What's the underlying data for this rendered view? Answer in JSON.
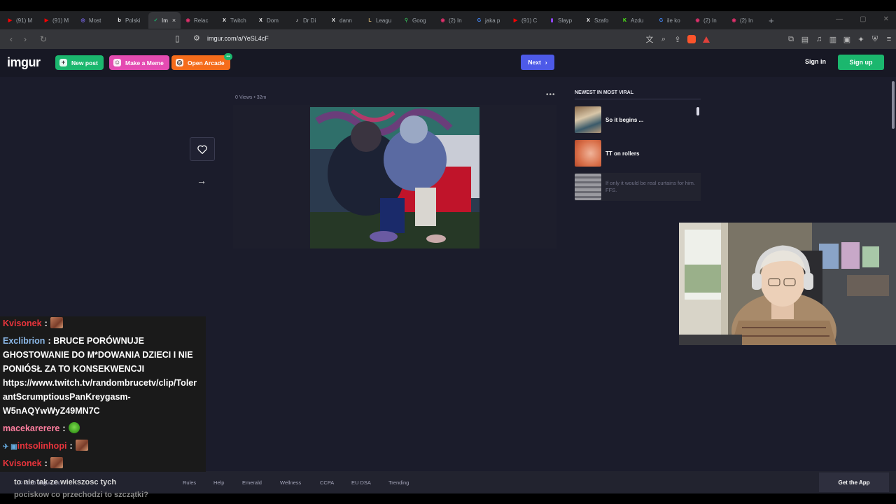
{
  "browser": {
    "tabs": [
      {
        "label": "(91) M",
        "icon": "youtube-icon",
        "color": "#ff0000"
      },
      {
        "label": "(91) M",
        "icon": "youtube-icon",
        "color": "#ff0000"
      },
      {
        "label": "Most",
        "icon": "globe-icon",
        "color": "#7b68ee"
      },
      {
        "label": "Polski",
        "icon": "bing-icon",
        "color": "#ffffff"
      },
      {
        "label": "Im",
        "icon": "imgur-icon",
        "color": "#1bb76e",
        "active": true
      },
      {
        "label": "Relac",
        "icon": "instagram-icon",
        "color": "#e1306c"
      },
      {
        "label": "Twitch",
        "icon": "x-icon",
        "color": "#ffffff"
      },
      {
        "label": "Dom",
        "icon": "x-icon",
        "color": "#ffffff"
      },
      {
        "label": "Dr Di",
        "icon": "tiktok-icon",
        "color": "#ffffff"
      },
      {
        "label": "dann",
        "icon": "x-icon",
        "color": "#ffffff"
      },
      {
        "label": "Leagu",
        "icon": "league-icon",
        "color": "#c8aa6e"
      },
      {
        "label": "Goog",
        "icon": "maps-icon",
        "color": "#34a853"
      },
      {
        "label": "(2) In",
        "icon": "instagram-icon",
        "color": "#e1306c"
      },
      {
        "label": "jaka p",
        "icon": "google-icon",
        "color": "#4285f4"
      },
      {
        "label": "(91) C",
        "icon": "youtube-icon",
        "color": "#ff0000"
      },
      {
        "label": "Slayp",
        "icon": "twitch-icon",
        "color": "#9146ff"
      },
      {
        "label": "Szafo",
        "icon": "x-icon",
        "color": "#ffffff"
      },
      {
        "label": "Azdu",
        "icon": "kick-icon",
        "color": "#53fc18"
      },
      {
        "label": "ile ko",
        "icon": "google-icon",
        "color": "#4285f4"
      },
      {
        "label": "(2) In",
        "icon": "instagram-icon",
        "color": "#e1306c"
      },
      {
        "label": "(2) In",
        "icon": "instagram-icon",
        "color": "#e1306c"
      }
    ],
    "new_tab": "+",
    "url": "imgur.com/a/YeSL4cF"
  },
  "imgur": {
    "logo": "imgur",
    "new_post": "New post",
    "make_meme": "Make a Meme",
    "open_arcade": "Open Arcade",
    "next": "Next",
    "sign_in": "Sign in",
    "sign_up": "Sign up",
    "post_meta": "0 Views • 32m",
    "viral_title": "NEWEST IN MOST VIRAL",
    "viral": [
      {
        "label": "So it begins ..."
      },
      {
        "label": "TT on rollers"
      },
      {
        "label": "If only it would be real curtains for him. FFS."
      }
    ],
    "footer": {
      "copyright": "© 2026 Imgur, Inc.",
      "links": [
        "Rules",
        "Help",
        "Emerald",
        "Wellness",
        "CCPA",
        "EU DSA",
        "Trending"
      ],
      "get_app": "Get the App"
    }
  },
  "chat": {
    "messages": [
      {
        "user": "Kvisonek",
        "color": "#e8343c",
        "text": ":",
        "emote": "brown"
      },
      {
        "user": "Exclibrion",
        "color": "#8bb8e8",
        "text": ": BRUCE PORÓWNUJE"
      },
      {
        "text": "GHOSTOWANIE DO M*DOWANIA DZIECI I NIE"
      },
      {
        "text": "PONIÓSŁ ZA TO KONSEKWENCJI"
      },
      {
        "text": "https://www.twitch.tv/randombrucetv/clip/Toler"
      },
      {
        "text": "antScrumptiousPanKreygasm-"
      },
      {
        "text": "W5nAQYwWyZ49MN7C"
      },
      {
        "user": "macekarerere",
        "color": "#ff7f9f",
        "text": ":",
        "emote": "green"
      },
      {
        "user": "intsolinhopi",
        "color": "#e8343c",
        "text": ":",
        "emote": "brown",
        "badges": "✈ ▣"
      },
      {
        "user": "Kvisonek",
        "color": "#e8343c",
        "text": ":",
        "emote": "brown"
      }
    ],
    "bottom_line1": "to nie tak ze wiekszosc tych",
    "bottom_line2": "pociskow co przechodzi to szczątki?"
  }
}
